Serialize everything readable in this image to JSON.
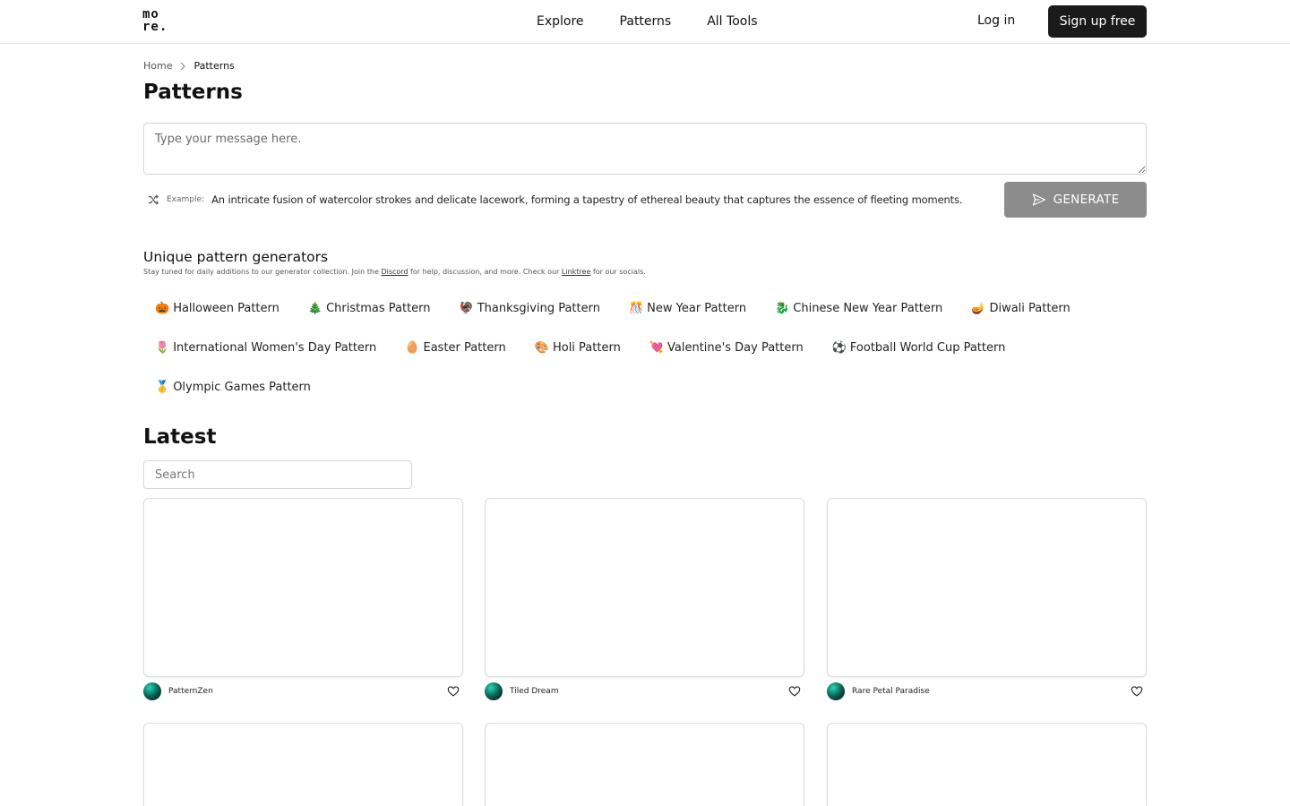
{
  "header": {
    "logo_line1": "mo",
    "logo_line2": "re.",
    "nav": [
      "Explore",
      "Patterns",
      "All Tools"
    ],
    "login": "Log in",
    "signup": "Sign up free"
  },
  "breadcrumb": {
    "home": "Home",
    "current": "Patterns"
  },
  "page_title": "Patterns",
  "composer": {
    "placeholder": "Type your message here.",
    "example_label": "Example:",
    "example_text": "An intricate fusion of watercolor strokes and delicate lacework, forming a tapestry of ethereal beauty that captures the essence of fleeting moments.",
    "generate_label": "GENERATE"
  },
  "generators": {
    "title": "Unique pattern generators",
    "sub_before": "Stay tuned for daily additions to our generator collection. Join the ",
    "discord": "Discord",
    "sub_middle": " for help, discussion, and more. Check our ",
    "linktree": "Linktree",
    "sub_after": " for our socials.",
    "rows": [
      [
        {
          "emoji": "🎃",
          "label": "Halloween Pattern"
        },
        {
          "emoji": "🎄",
          "label": "Christmas Pattern"
        },
        {
          "emoji": "🦃",
          "label": "Thanksgiving Pattern"
        },
        {
          "emoji": "🎊",
          "label": "New Year Pattern"
        },
        {
          "emoji": "🐉",
          "label": "Chinese New Year Pattern"
        },
        {
          "emoji": "🪔",
          "label": "Diwali Pattern"
        }
      ],
      [
        {
          "emoji": "🌷",
          "label": "International Women's Day Pattern"
        },
        {
          "emoji": "🥚",
          "label": "Easter Pattern"
        },
        {
          "emoji": "🎨",
          "label": "Holi Pattern"
        },
        {
          "emoji": "💘",
          "label": "Valentine's Day Pattern"
        },
        {
          "emoji": "⚽",
          "label": "Football World Cup Pattern"
        }
      ],
      [
        {
          "emoji": "🥇",
          "label": "Olympic Games Pattern"
        }
      ]
    ]
  },
  "latest": {
    "title": "Latest",
    "search_placeholder": "Search",
    "cards": [
      {
        "author": "PatternZen"
      },
      {
        "author": "Tiled Dream"
      },
      {
        "author": "Rare Petal Paradise"
      }
    ]
  },
  "icons": {
    "shuffle": "shuffle-icon",
    "send": "send-icon",
    "heart": "heart-icon",
    "chevron": "chevron-right-icon"
  },
  "colors": {
    "primary_button": "#1a1a1a",
    "generate_button": "#8c8c8c",
    "border": "#d4d4d4"
  }
}
